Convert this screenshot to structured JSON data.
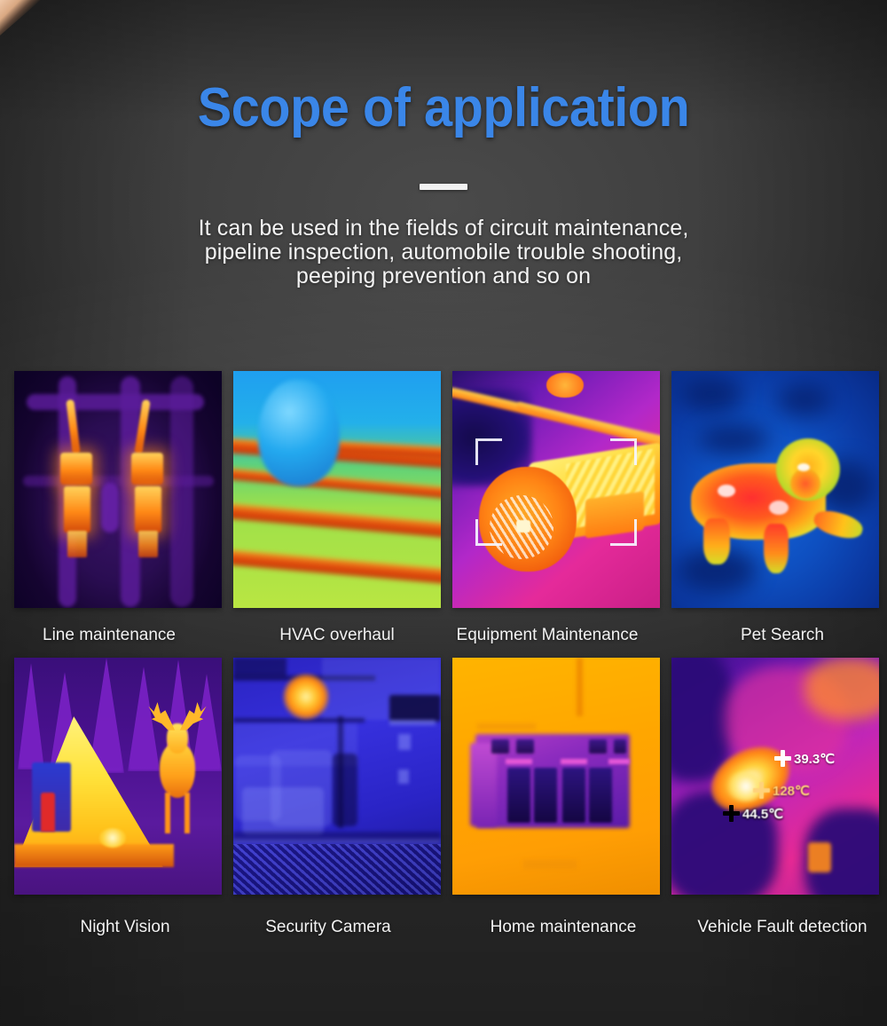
{
  "header": {
    "title": "Scope of application",
    "title_color": "#3a86e8",
    "subtitle_line1": "It can be used in the fields of circuit maintenance,",
    "subtitle_line2": "pipeline inspection, automobile trouble shooting,",
    "subtitle_line3": "peeping prevention and so on"
  },
  "gallery": {
    "items": [
      {
        "caption": "Line maintenance",
        "scene": "thermal-electrical-fuses"
      },
      {
        "caption": "HVAC overhaul",
        "scene": "thermal-hvac-pipes"
      },
      {
        "caption": "Equipment Maintenance",
        "scene": "thermal-electric-motor"
      },
      {
        "caption": "Pet Search",
        "scene": "thermal-dog"
      },
      {
        "caption": "Night Vision",
        "scene": "thermal-cabin-deer"
      },
      {
        "caption": "Security Camera",
        "scene": "thermal-bedroom-hotspot"
      },
      {
        "caption": "Home maintenance",
        "scene": "thermal-wall-panel"
      },
      {
        "caption": "Vehicle Fault detection",
        "scene": "thermal-engine-bay"
      }
    ]
  },
  "vehicle_readings": [
    {
      "value": "39.3℃",
      "marker_color": "#ffffff"
    },
    {
      "value": "128℃",
      "marker_color": "#ffd27a"
    },
    {
      "value": "44.5℃",
      "marker_color": "#000000"
    }
  ]
}
